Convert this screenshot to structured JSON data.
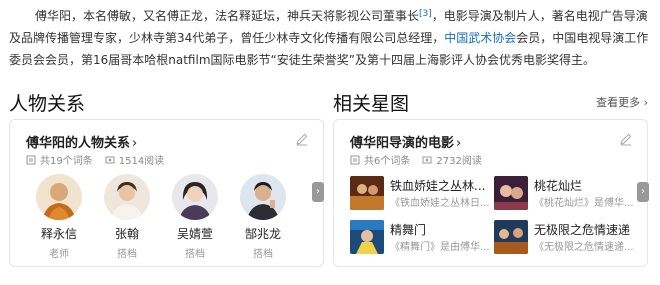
{
  "intro": {
    "part1": "傅华阳，本名傅敏，又名傅正龙，法名释延坛，神兵天将影视公司董事长",
    "ref": "[3]",
    "part2": "，电影导演及制片人，著名电视广告导演及品牌传播管理专家，少林寺第34代弟子，曾任少林寺文化传播有限公司总经理，",
    "link": "中国武术协会",
    "part3": "会员，中国电视导演工作委员会会员，第16届哥本哈根natfilm国际电影节“安徒生荣誉奖”及第十四届上海影评人协会优秀电影奖得主。"
  },
  "relations": {
    "section_title": "人物关系",
    "card_title": "傅华阳的人物关系",
    "chevron": "›",
    "entries_count": "共19个词条",
    "views": "1514阅读",
    "people": [
      {
        "name": "释永信",
        "role": "老师"
      },
      {
        "name": "张翰",
        "role": "搭档"
      },
      {
        "name": "吴婧萱",
        "role": "搭档"
      },
      {
        "name": "郜兆龙",
        "role": "搭档"
      }
    ],
    "next": "›"
  },
  "stars": {
    "section_title": "相关星图",
    "more": "查看更多 ›",
    "card_title": "傅华阳导演的电影",
    "chevron": "›",
    "entries_count": "共6个词条",
    "views": "2732阅读",
    "movies": [
      {
        "title": "铁血娇娃之丛林...",
        "desc": "《铁血娇娃之丛林日..."
      },
      {
        "title": "桃花灿烂",
        "desc": "《桃花灿烂》是傅华..."
      },
      {
        "title": "精舞门",
        "desc": "《精舞门》是由傅华..."
      },
      {
        "title": "无极限之危情速递",
        "desc": "《无极限之危情速递..."
      }
    ],
    "next": "›"
  },
  "colors": {
    "link": "#136ec2",
    "muted": "#999999",
    "arrow_bg": "#999999"
  }
}
